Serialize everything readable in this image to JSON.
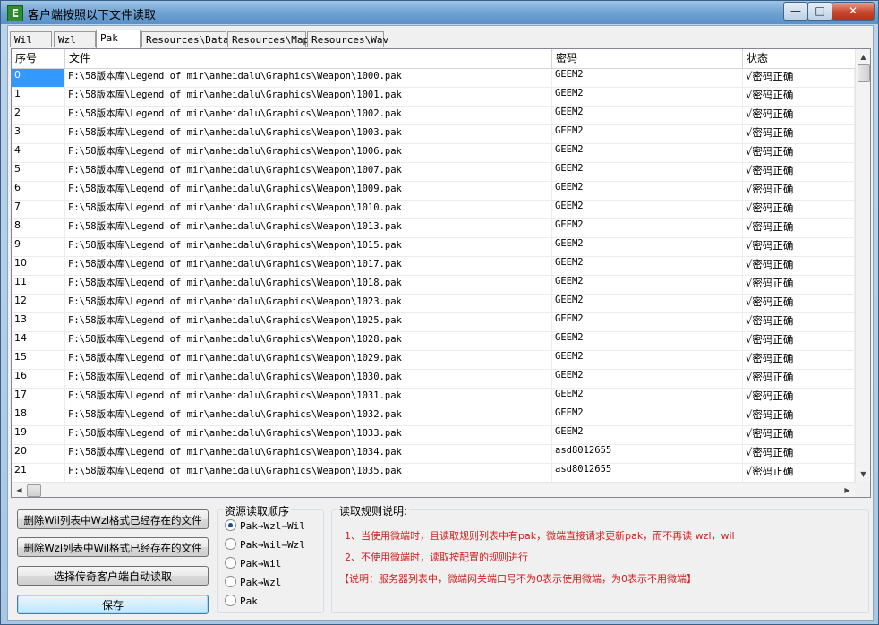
{
  "window": {
    "title": "客户端按照以下文件读取",
    "app_icon_letter": "E",
    "min_symbol": "—",
    "max_symbol": "□",
    "close_symbol": "✕"
  },
  "tabs": [
    "Wil",
    "Wzl",
    "Pak",
    "Resources\\Data",
    "Resources\\Map",
    "Resources\\Wav"
  ],
  "active_tab": "Pak",
  "table": {
    "headers": [
      "序号",
      "文件",
      "密码",
      "状态"
    ],
    "rows": [
      {
        "index": "0",
        "file": "F:\\58版本库\\Legend of mir\\anheidalu\\Graphics\\Weapon\\1000.pak",
        "password": "GEEM2",
        "status": "√密码正确"
      },
      {
        "index": "1",
        "file": "F:\\58版本库\\Legend of mir\\anheidalu\\Graphics\\Weapon\\1001.pak",
        "password": "GEEM2",
        "status": "√密码正确"
      },
      {
        "index": "2",
        "file": "F:\\58版本库\\Legend of mir\\anheidalu\\Graphics\\Weapon\\1002.pak",
        "password": "GEEM2",
        "status": "√密码正确"
      },
      {
        "index": "3",
        "file": "F:\\58版本库\\Legend of mir\\anheidalu\\Graphics\\Weapon\\1003.pak",
        "password": "GEEM2",
        "status": "√密码正确"
      },
      {
        "index": "4",
        "file": "F:\\58版本库\\Legend of mir\\anheidalu\\Graphics\\Weapon\\1006.pak",
        "password": "GEEM2",
        "status": "√密码正确"
      },
      {
        "index": "5",
        "file": "F:\\58版本库\\Legend of mir\\anheidalu\\Graphics\\Weapon\\1007.pak",
        "password": "GEEM2",
        "status": "√密码正确"
      },
      {
        "index": "6",
        "file": "F:\\58版本库\\Legend of mir\\anheidalu\\Graphics\\Weapon\\1009.pak",
        "password": "GEEM2",
        "status": "√密码正确"
      },
      {
        "index": "7",
        "file": "F:\\58版本库\\Legend of mir\\anheidalu\\Graphics\\Weapon\\1010.pak",
        "password": "GEEM2",
        "status": "√密码正确"
      },
      {
        "index": "8",
        "file": "F:\\58版本库\\Legend of mir\\anheidalu\\Graphics\\Weapon\\1013.pak",
        "password": "GEEM2",
        "status": "√密码正确"
      },
      {
        "index": "9",
        "file": "F:\\58版本库\\Legend of mir\\anheidalu\\Graphics\\Weapon\\1015.pak",
        "password": "GEEM2",
        "status": "√密码正确"
      },
      {
        "index": "10",
        "file": "F:\\58版本库\\Legend of mir\\anheidalu\\Graphics\\Weapon\\1017.pak",
        "password": "GEEM2",
        "status": "√密码正确"
      },
      {
        "index": "11",
        "file": "F:\\58版本库\\Legend of mir\\anheidalu\\Graphics\\Weapon\\1018.pak",
        "password": "GEEM2",
        "status": "√密码正确"
      },
      {
        "index": "12",
        "file": "F:\\58版本库\\Legend of mir\\anheidalu\\Graphics\\Weapon\\1023.pak",
        "password": "GEEM2",
        "status": "√密码正确"
      },
      {
        "index": "13",
        "file": "F:\\58版本库\\Legend of mir\\anheidalu\\Graphics\\Weapon\\1025.pak",
        "password": "GEEM2",
        "status": "√密码正确"
      },
      {
        "index": "14",
        "file": "F:\\58版本库\\Legend of mir\\anheidalu\\Graphics\\Weapon\\1028.pak",
        "password": "GEEM2",
        "status": "√密码正确"
      },
      {
        "index": "15",
        "file": "F:\\58版本库\\Legend of mir\\anheidalu\\Graphics\\Weapon\\1029.pak",
        "password": "GEEM2",
        "status": "√密码正确"
      },
      {
        "index": "16",
        "file": "F:\\58版本库\\Legend of mir\\anheidalu\\Graphics\\Weapon\\1030.pak",
        "password": "GEEM2",
        "status": "√密码正确"
      },
      {
        "index": "17",
        "file": "F:\\58版本库\\Legend of mir\\anheidalu\\Graphics\\Weapon\\1031.pak",
        "password": "GEEM2",
        "status": "√密码正确"
      },
      {
        "index": "18",
        "file": "F:\\58版本库\\Legend of mir\\anheidalu\\Graphics\\Weapon\\1032.pak",
        "password": "GEEM2",
        "status": "√密码正确"
      },
      {
        "index": "19",
        "file": "F:\\58版本库\\Legend of mir\\anheidalu\\Graphics\\Weapon\\1033.pak",
        "password": "GEEM2",
        "status": "√密码正确"
      },
      {
        "index": "20",
        "file": "F:\\58版本库\\Legend of mir\\anheidalu\\Graphics\\Weapon\\1034.pak",
        "password": "asd8012655",
        "status": "√密码正确"
      },
      {
        "index": "21",
        "file": "F:\\58版本库\\Legend of mir\\anheidalu\\Graphics\\Weapon\\1035.pak",
        "password": "asd8012655",
        "status": "√密码正确"
      }
    ],
    "selected_index": "0"
  },
  "buttons": {
    "delete_wil": "删除Wil列表中Wzl格式已经存在的文件",
    "delete_wzl": "删除Wzl列表中Wil格式已经存在的文件",
    "select_client": "选择传奇客户端自动读取",
    "save": "保存"
  },
  "read_order": {
    "title": "资源读取顺序",
    "options": [
      "Pak→Wzl→Wil",
      "Pak→Wil→Wzl",
      "Pak→Wil",
      "Pak→Wzl",
      "Pak"
    ],
    "selected": "Pak→Wzl→Wil"
  },
  "rules": {
    "title": "读取规则说明:",
    "line1": "1、当使用微端时，且读取规则列表中有pak，微端直接请求更新pak，而不再读 wzl，wil",
    "line2": "2、不使用微端时，读取按配置的规则进行",
    "line3": "【说明：服务器列表中，微端网关端口号不为0表示使用微端，为0表示不用微端】"
  },
  "colors": {
    "selection": "#3399ff",
    "rule_text": "#d21e1e"
  }
}
